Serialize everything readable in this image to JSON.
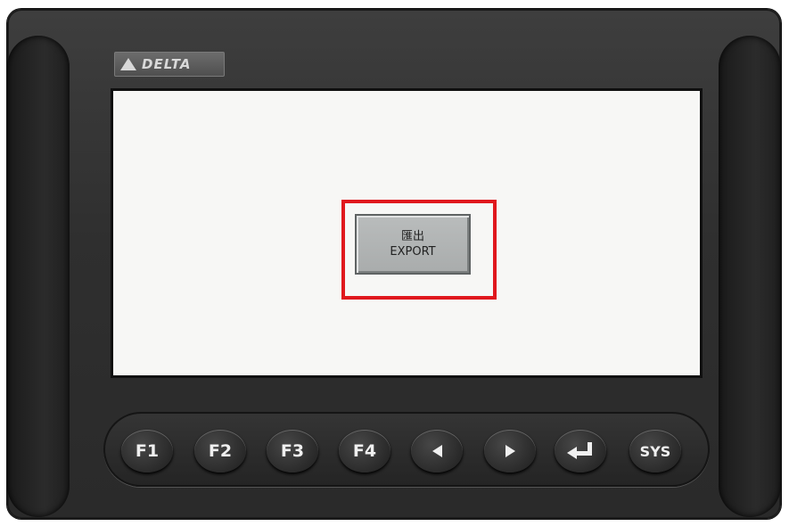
{
  "device": {
    "brand": "DELTA"
  },
  "screen": {
    "export_button": {
      "label_cn": "匯出",
      "label_en": "EXPORT"
    },
    "highlight_color": "#e0181d"
  },
  "keypad": {
    "keys": [
      {
        "label": "F1"
      },
      {
        "label": "F2"
      },
      {
        "label": "F3"
      },
      {
        "label": "F4"
      },
      {
        "label": "",
        "icon": "arrow-left-icon"
      },
      {
        "label": "",
        "icon": "arrow-right-icon"
      },
      {
        "label": "",
        "icon": "enter-icon"
      },
      {
        "label": "SYS"
      }
    ],
    "led_color": "#e5d820"
  }
}
